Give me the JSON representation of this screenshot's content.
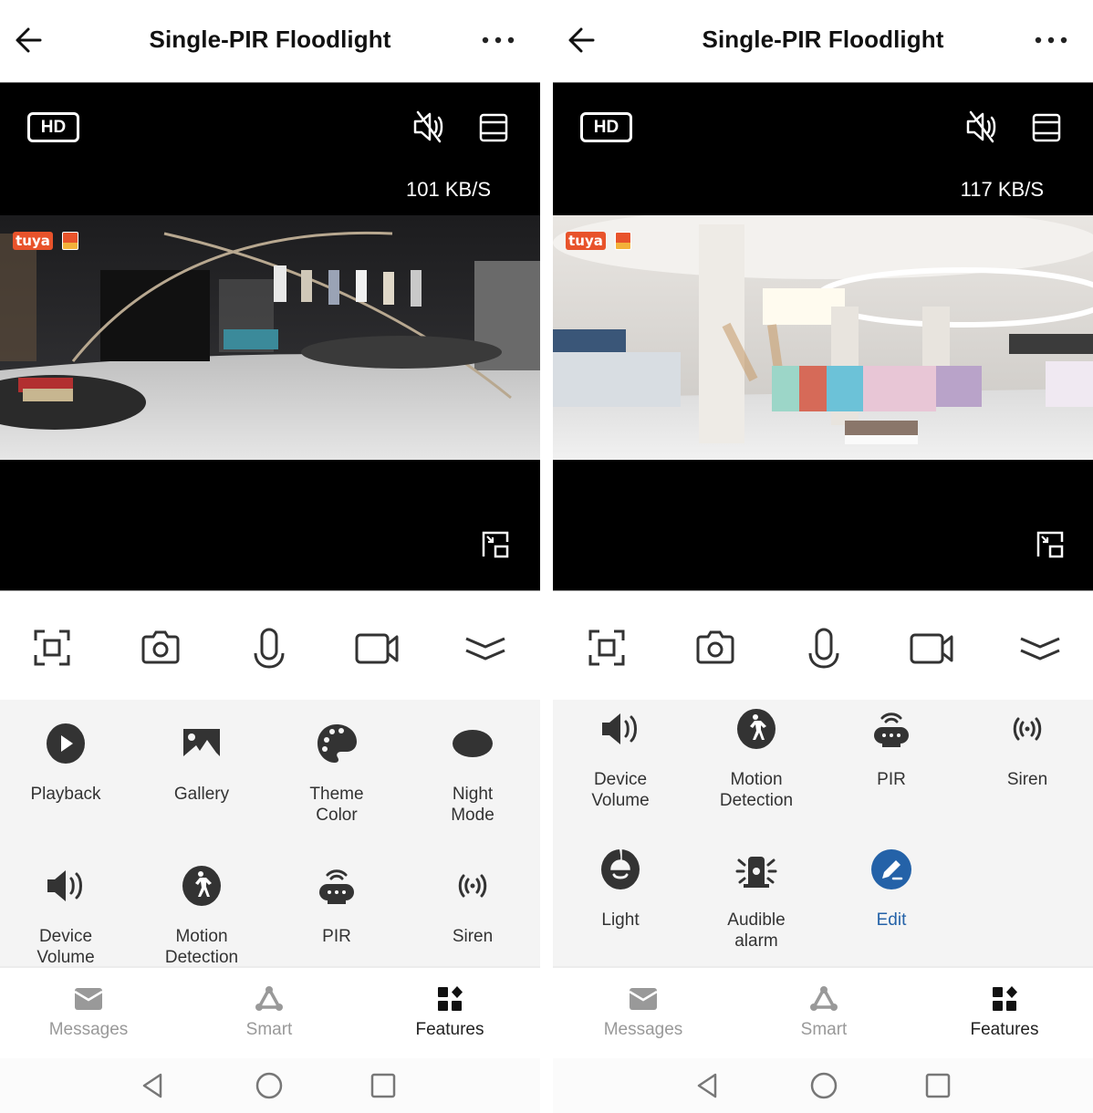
{
  "screens": [
    {
      "id": "left",
      "header": {
        "title": "Single-PIR Floodlight",
        "back_icon": "arrow-left-icon",
        "more_icon": "more-horizontal-icon"
      },
      "video": {
        "quality_label": "HD",
        "data_rate": "101 KB/S",
        "mute_icon": "speaker-muted-icon",
        "layout_icon": "layout-icon",
        "pip_icon": "picture-in-picture-icon",
        "watermark_brand": "tuya",
        "scene": "dark boutique interior"
      },
      "controls": [
        {
          "name": "screenshot-frame",
          "icon": "scan-frame-icon"
        },
        {
          "name": "snapshot",
          "icon": "camera-icon"
        },
        {
          "name": "talk",
          "icon": "microphone-icon"
        },
        {
          "name": "record",
          "icon": "video-camera-icon"
        },
        {
          "name": "collapse",
          "icon": "chevron-double-down-icon"
        }
      ],
      "features": [
        {
          "label": "Playback",
          "icon": "play-circle-icon"
        },
        {
          "label": "Gallery",
          "icon": "image-icon"
        },
        {
          "label": "Theme Color",
          "icon": "palette-icon"
        },
        {
          "label": "Night Mode",
          "icon": "night-eye-icon"
        },
        {
          "label": "Device Volume",
          "icon": "speaker-icon"
        },
        {
          "label": "Motion Detection",
          "icon": "walking-person-icon"
        },
        {
          "label": "PIR",
          "icon": "pir-sensor-icon"
        },
        {
          "label": "Siren",
          "icon": "broadcast-icon"
        }
      ],
      "tabs": [
        {
          "label": "Messages",
          "icon": "envelope-icon",
          "active": false
        },
        {
          "label": "Smart",
          "icon": "smart-nodes-icon",
          "active": false
        },
        {
          "label": "Features",
          "icon": "grid-features-icon",
          "active": true
        }
      ]
    },
    {
      "id": "right",
      "header": {
        "title": "Single-PIR Floodlight",
        "back_icon": "arrow-left-icon",
        "more_icon": "more-horizontal-icon"
      },
      "video": {
        "quality_label": "HD",
        "data_rate": "117 KB/S",
        "mute_icon": "speaker-muted-icon",
        "layout_icon": "layout-icon",
        "pip_icon": "picture-in-picture-icon",
        "watermark_brand": "tuya",
        "scene": "bright shopping mall interior"
      },
      "controls": [
        {
          "name": "screenshot-frame",
          "icon": "scan-frame-icon"
        },
        {
          "name": "snapshot",
          "icon": "camera-icon"
        },
        {
          "name": "talk",
          "icon": "microphone-icon"
        },
        {
          "name": "record",
          "icon": "video-camera-icon"
        },
        {
          "name": "collapse",
          "icon": "chevron-double-down-icon"
        }
      ],
      "features": [
        {
          "label": "Device Volume",
          "icon": "speaker-icon"
        },
        {
          "label": "Motion Detection",
          "icon": "walking-person-icon"
        },
        {
          "label": "PIR",
          "icon": "pir-sensor-icon"
        },
        {
          "label": "Siren",
          "icon": "broadcast-icon"
        },
        {
          "label": "Light",
          "icon": "lamp-icon"
        },
        {
          "label": "Audible alarm",
          "icon": "alarm-beacon-icon"
        },
        {
          "label": "Edit",
          "icon": "edit-pencil-icon"
        }
      ],
      "tabs": [
        {
          "label": "Messages",
          "icon": "envelope-icon",
          "active": false
        },
        {
          "label": "Smart",
          "icon": "smart-nodes-icon",
          "active": false
        },
        {
          "label": "Features",
          "icon": "grid-features-icon",
          "active": true
        }
      ]
    }
  ],
  "system_nav": [
    {
      "name": "back",
      "icon": "triangle-back-icon"
    },
    {
      "name": "home",
      "icon": "circle-home-icon"
    },
    {
      "name": "recents",
      "icon": "square-recents-icon"
    }
  ],
  "colors": {
    "accent_edit": "#2462a8",
    "brand_tuya": "#e8532b",
    "icon_dark": "#333333",
    "tab_inactive": "#999999"
  }
}
